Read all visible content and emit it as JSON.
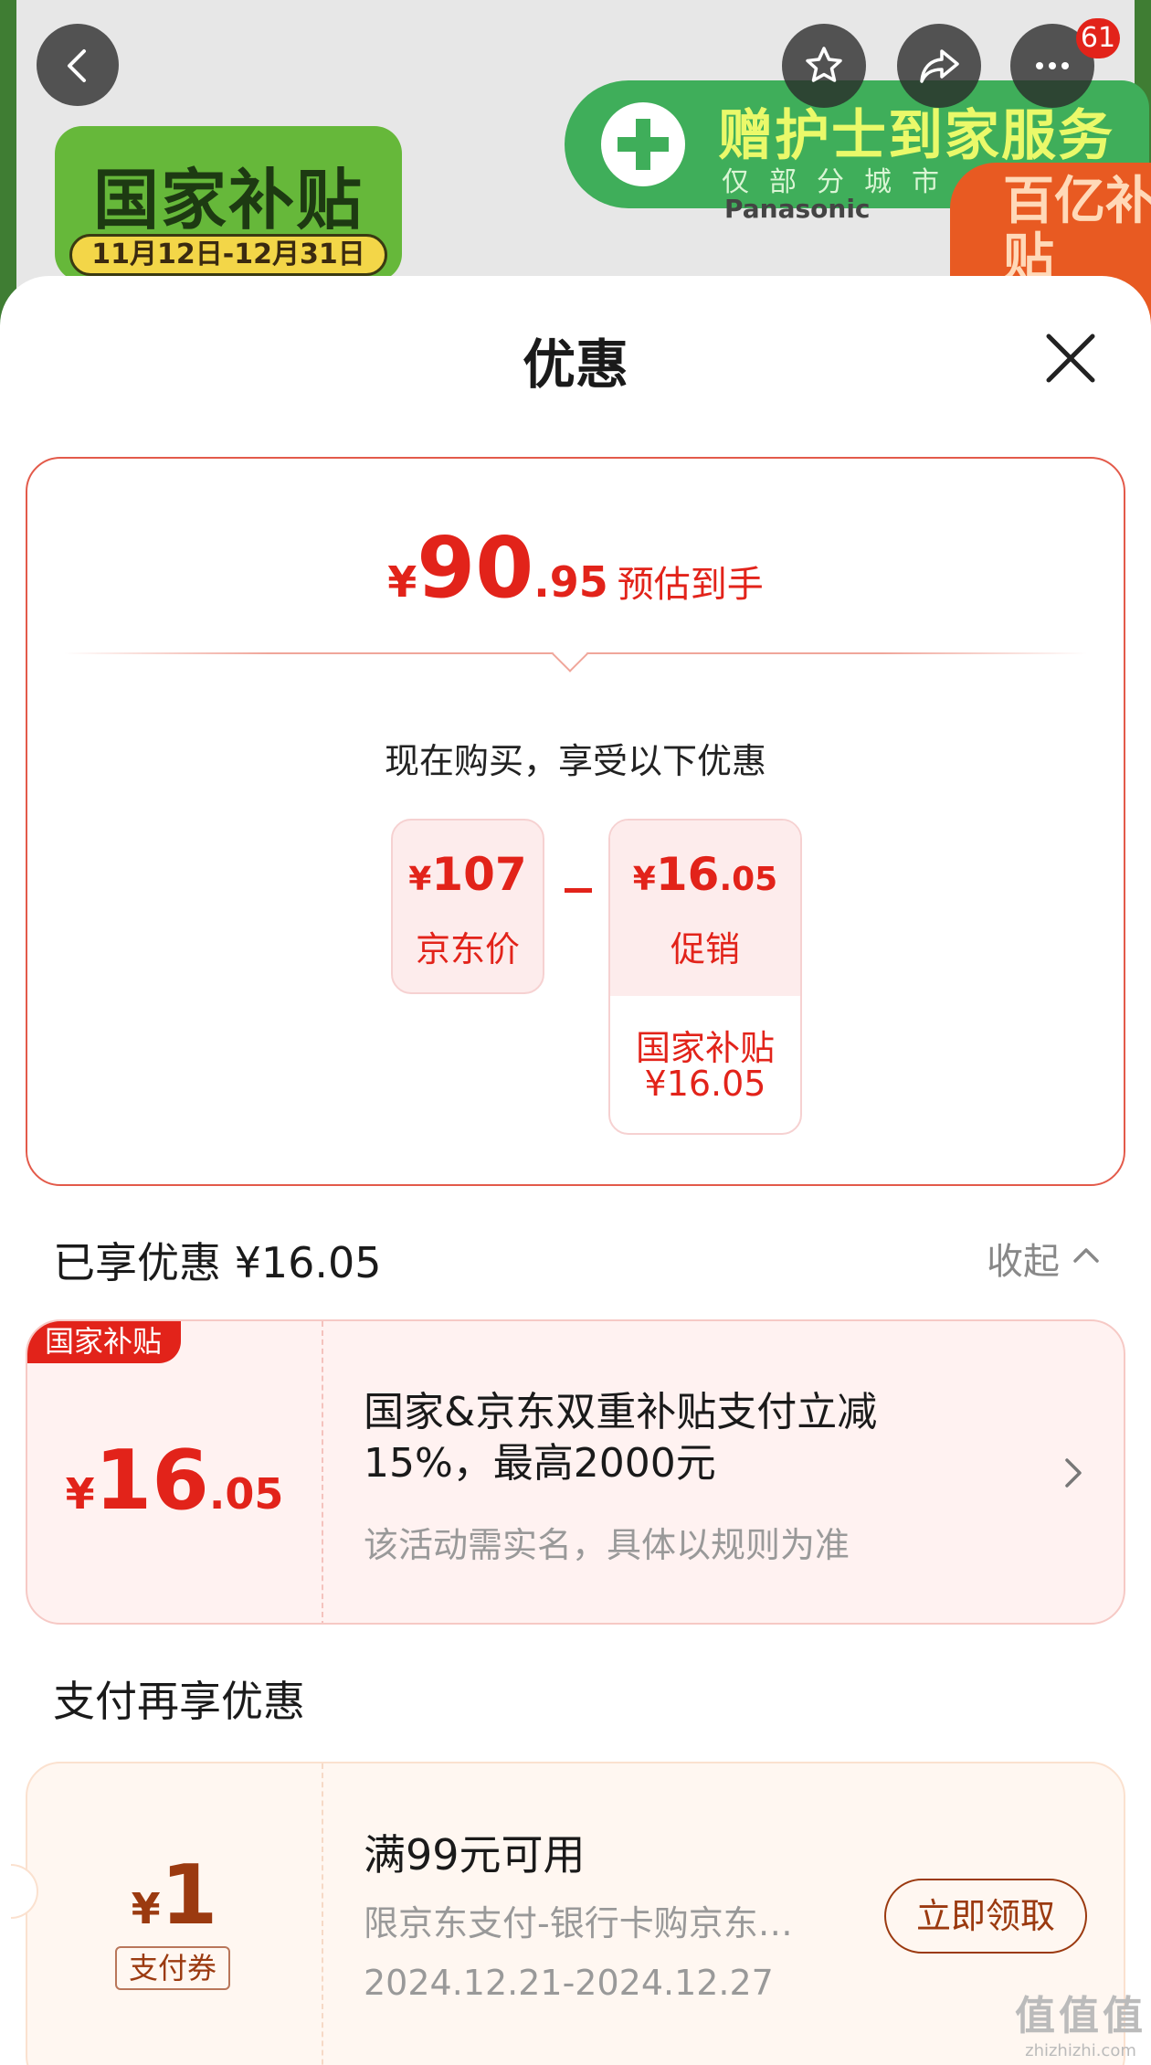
{
  "banner": {
    "subsidy_title": "国家补贴",
    "subsidy_dates": "11月12日-12月31日",
    "promo_main": "赠护士到家服务",
    "promo_sub": "仅部分城市",
    "brand": "Panasonic",
    "corner_badge": "百亿补贴",
    "more_badge_count": "61",
    "icons": [
      "back-icon",
      "star-icon",
      "share-icon",
      "more-icon"
    ]
  },
  "sheet": {
    "title": "优惠",
    "close_icon": "close-icon"
  },
  "summary": {
    "currency": "¥",
    "estimate_int": "90",
    "estimate_dec": ".95",
    "estimate_label": "预估到手",
    "enjoy_text": "现在购买，享受以下优惠",
    "jd_price_currency": "¥",
    "jd_price": "107",
    "jd_price_label": "京东价",
    "operator": "-",
    "promo_currency": "¥",
    "promo_int": "16",
    "promo_dec": ".05",
    "promo_label": "促销",
    "promo_detail_name": "国家补贴",
    "promo_detail_amount": "¥16.05"
  },
  "enjoyed": {
    "title": "已享优惠 ¥16.05",
    "collapse_label": "收起"
  },
  "subsidy_coupon": {
    "tag": "国家补贴",
    "currency": "¥",
    "amount_int": "16",
    "amount_dec": ".05",
    "description": "国家&京东双重补贴支付立减15%，最高2000元",
    "note": "该活动需实名，具体以规则为准"
  },
  "payment": {
    "title": "支付再享优惠",
    "coupon": {
      "currency": "¥",
      "amount": "1",
      "type": "支付券",
      "condition": "满99元可用",
      "limit": "限京东支付-银行卡购京东…",
      "period": "2024.12.21-2024.12.27",
      "claim_label": "立即领取"
    }
  },
  "watermark": {
    "logo": "值值值",
    "site": "zhizhizhi.com"
  },
  "colors": {
    "accent_red": "#e2231a",
    "coupon_brown": "#9b3a10"
  }
}
